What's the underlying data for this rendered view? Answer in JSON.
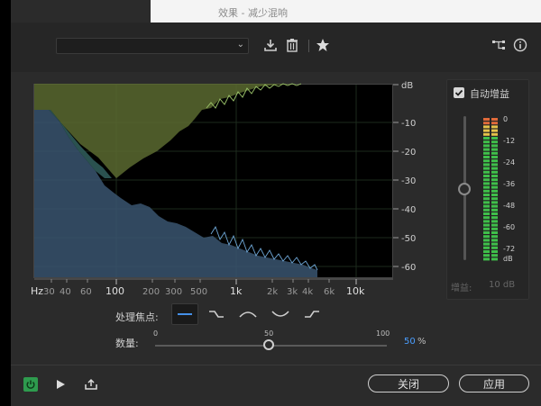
{
  "window": {
    "title": "效果 - 减少混响"
  },
  "toolbar": {
    "preset_value": "",
    "icons": [
      "save-preset-icon",
      "trash-icon",
      "star-icon",
      "routing-icon",
      "info-icon"
    ]
  },
  "plot": {
    "y_unit": "dB",
    "y_ticks": [
      "-10",
      "-20",
      "-30",
      "-40",
      "-50",
      "-60"
    ],
    "x_unit": "Hz",
    "x_ticks": [
      "30",
      "40",
      "60",
      "100",
      "200",
      "300",
      "500",
      "1k",
      "2k",
      "3k",
      "4k",
      "6k",
      "10k"
    ],
    "colors": {
      "before": "#5a6a30",
      "after": "#3a5570",
      "overlap": "#2f5a58"
    }
  },
  "gain": {
    "auto_gain_label": "自动增益",
    "auto_gain_checked": true,
    "meter_ticks": [
      "0",
      "-12",
      "-24",
      "-36",
      "-48",
      "-60",
      "-72",
      "dB"
    ],
    "footer_label": "增益:",
    "footer_value": "10 dB"
  },
  "focus": {
    "label": "处理焦点:",
    "options": [
      "flat",
      "low-shelf",
      "hill",
      "dip",
      "high-shelf"
    ],
    "selected": 0
  },
  "amount": {
    "label": "数量:",
    "tick_labels": [
      "0",
      "50",
      "100"
    ],
    "value": 50,
    "value_text": "50",
    "unit": "%"
  },
  "footer": {
    "close_label": "关闭",
    "apply_label": "应用"
  }
}
